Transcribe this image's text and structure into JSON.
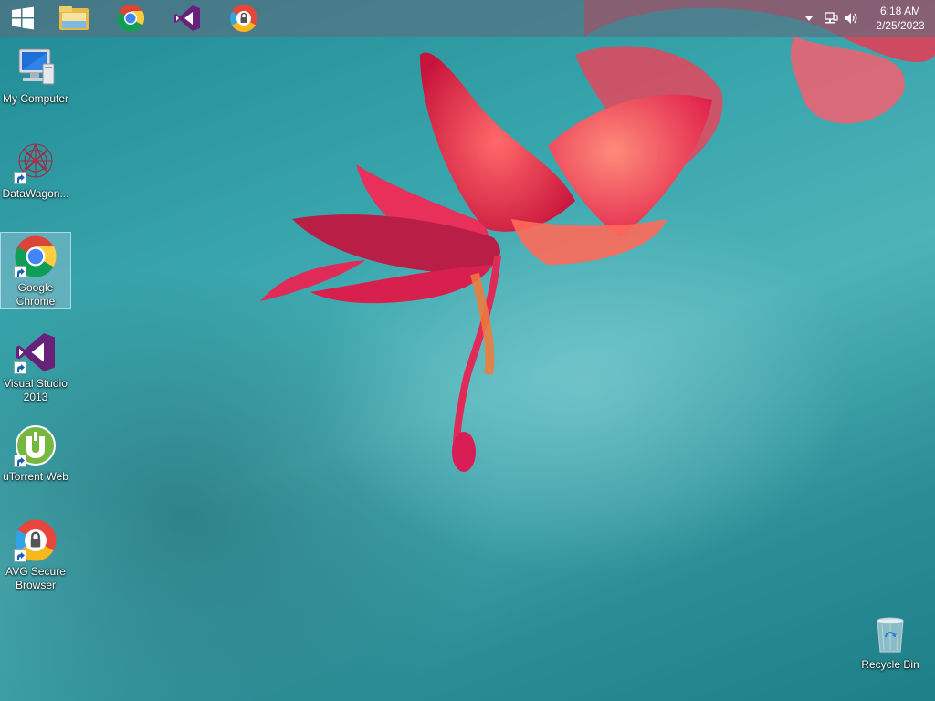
{
  "taskbar": {
    "pinned": [
      {
        "name": "start-button",
        "icon": "windows-logo-icon"
      },
      {
        "name": "file-explorer",
        "icon": "folder-icon"
      },
      {
        "name": "google-chrome",
        "icon": "chrome-icon"
      },
      {
        "name": "visual-studio",
        "icon": "visual-studio-icon"
      },
      {
        "name": "avg-secure-browser",
        "icon": "avg-browser-icon"
      }
    ],
    "tray": {
      "time": "6:18 AM",
      "date": "2/25/2023",
      "icons": [
        "chevron-up-icon",
        "network-icon",
        "volume-icon"
      ]
    }
  },
  "desktop": {
    "icons": [
      {
        "label": "My Computer",
        "icon": "computer-icon",
        "shortcut": false
      },
      {
        "label": "DataWagon...",
        "icon": "datawagon-icon",
        "shortcut": true
      },
      {
        "label": "Google\nChrome",
        "icon": "chrome-icon",
        "shortcut": true,
        "selected": true
      },
      {
        "label": "Visual Studio\n2013",
        "icon": "visual-studio-icon",
        "shortcut": true
      },
      {
        "label": "uTorrent Web",
        "icon": "utorrent-icon",
        "shortcut": true
      },
      {
        "label": "AVG Secure\nBrowser",
        "icon": "avg-browser-icon",
        "shortcut": true
      },
      {
        "label": "Recycle Bin",
        "icon": "recycle-bin-icon",
        "shortcut": false
      }
    ]
  },
  "colors": {
    "wallpaper_teal": "#3aa6ad",
    "flower_red": "#e0284a",
    "taskbar": "#5c6e80",
    "vs_purple": "#68217a",
    "utorrent_green": "#76b83f"
  }
}
